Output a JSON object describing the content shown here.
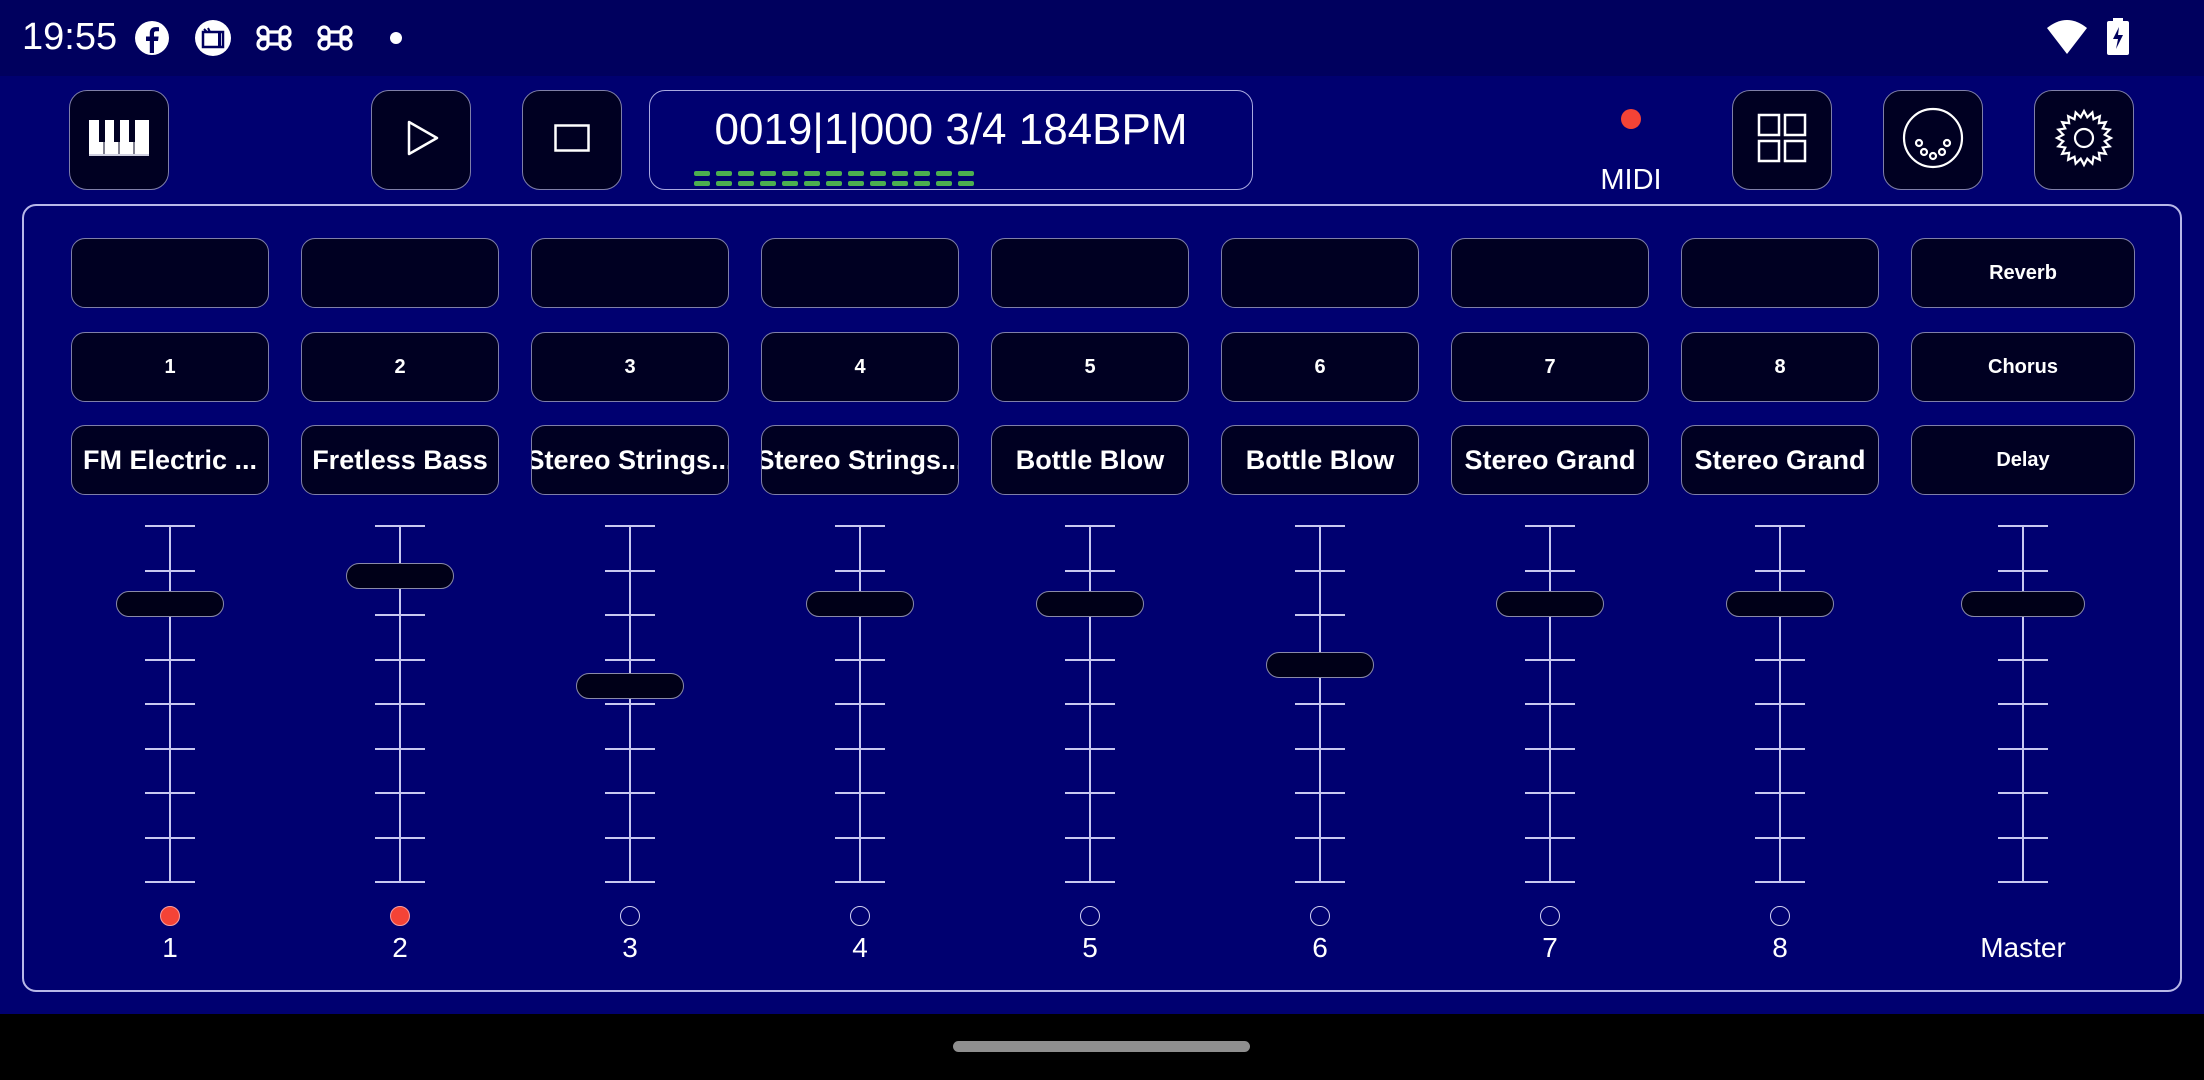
{
  "status_bar": {
    "time": "19:55",
    "left_icons": [
      "facebook-icon",
      "tv-app-icon",
      "command-icon",
      "command-icon",
      "dot-icon"
    ],
    "right_icons": [
      "wifi-icon",
      "battery-charging-icon"
    ]
  },
  "toolbar": {
    "buttons": [
      {
        "name": "keyboard-button",
        "icon": "piano-keys-icon"
      },
      {
        "name": "play-button",
        "icon": "play-icon"
      },
      {
        "name": "stop-button",
        "icon": "stop-icon"
      },
      {
        "name": "pads-button",
        "icon": "grid-icon"
      },
      {
        "name": "midi-port-button",
        "icon": "midi-din-icon"
      },
      {
        "name": "settings-button",
        "icon": "gear-icon"
      }
    ],
    "transport": {
      "display": "0019|1|000 3/4 184BPM",
      "position": "0019|1|000",
      "time_signature": "3/4",
      "tempo_bpm": 184,
      "beat_indicator_segments": 13
    },
    "midi": {
      "label": "MIDI",
      "activity_color": "#f44336",
      "active": true
    }
  },
  "mixer": {
    "channels": [
      {
        "number": "1",
        "top_slot": "",
        "id_label": "1",
        "instrument": "FM Electric ...",
        "fader_level": 0.78,
        "record_armed": true,
        "footer": "1"
      },
      {
        "number": "2",
        "top_slot": "",
        "id_label": "2",
        "instrument": "Fretless Bass",
        "fader_level": 0.86,
        "record_armed": true,
        "footer": "2"
      },
      {
        "number": "3",
        "top_slot": "",
        "id_label": "3",
        "instrument": "Stereo Strings...",
        "fader_level": 0.55,
        "record_armed": false,
        "footer": "3"
      },
      {
        "number": "4",
        "top_slot": "",
        "id_label": "4",
        "instrument": "Stereo Strings...",
        "fader_level": 0.78,
        "record_armed": false,
        "footer": "4"
      },
      {
        "number": "5",
        "top_slot": "",
        "id_label": "5",
        "instrument": "Bottle Blow",
        "fader_level": 0.78,
        "record_armed": false,
        "footer": "5"
      },
      {
        "number": "6",
        "top_slot": "",
        "id_label": "6",
        "instrument": "Bottle Blow",
        "fader_level": 0.61,
        "record_armed": false,
        "footer": "6"
      },
      {
        "number": "7",
        "top_slot": "",
        "id_label": "7",
        "instrument": "Stereo Grand",
        "fader_level": 0.78,
        "record_armed": false,
        "footer": "7"
      },
      {
        "number": "8",
        "top_slot": "",
        "id_label": "8",
        "instrument": "Stereo Grand",
        "fader_level": 0.78,
        "record_armed": false,
        "footer": "8"
      }
    ],
    "master": {
      "effects": [
        "Reverb",
        "Chorus",
        "Delay"
      ],
      "fader_level": 0.78,
      "footer": "Master"
    },
    "fader_tick_count": 9
  },
  "colors": {
    "background": "#000070",
    "status_bar": "#00005e",
    "button_fill": "#000022",
    "record_on": "#f44336",
    "beat_indicator": "#4caf50"
  }
}
